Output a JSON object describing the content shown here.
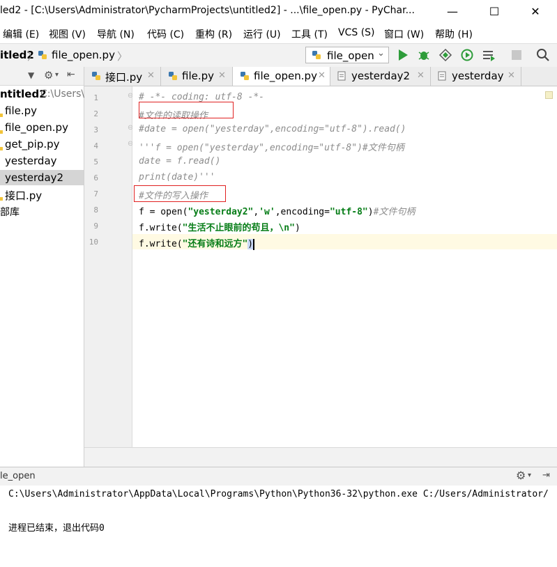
{
  "window": {
    "title": "led2 - [C:\\Users\\Administrator\\PycharmProjects\\untitled2] - ...\\file_open.py - PyChar...",
    "minimize": "—",
    "maximize": "☐",
    "close": "✕"
  },
  "menu": [
    "编辑 (E)",
    "视图 (V)",
    "导航 (N)",
    "代码 (C)",
    "重构 (R)",
    "运行 (U)",
    "工具 (T)",
    "VCS (S)",
    "窗口 (W)",
    "帮助 (H)"
  ],
  "breadcrumb": {
    "project": "itled2",
    "file": "file_open.py"
  },
  "run_config": {
    "name": "file_open"
  },
  "project_panel": {
    "root": "ntitled2",
    "root_path": "C:\\Users\\",
    "items": [
      "file.py",
      "file_open.py",
      "get_pip.py",
      "yesterday",
      "yesterday2",
      "接口.py",
      "部库"
    ],
    "selected_index": 4
  },
  "tabs": [
    {
      "label": "接口.py"
    },
    {
      "label": "file.py"
    },
    {
      "label": "file_open.py",
      "active": true
    },
    {
      "label": "yesterday2"
    },
    {
      "label": "yesterday"
    }
  ],
  "line_numbers": [
    "1",
    "2",
    "3",
    "4",
    "5",
    "6",
    "7",
    "8",
    "9",
    "10"
  ],
  "code": {
    "l1": "# -*- coding: utf-8 -*-",
    "l2": "#文件的读取操作",
    "l3": "#date = open(\"yesterday\",encoding=\"utf-8\").read()",
    "l4": "'''f = open(\"yesterday\",encoding=\"utf-8\")#文件句柄",
    "l5": "date = f.read()",
    "l6": "print(date)'''",
    "l7": "#文件的写入操作",
    "l8a": "f = open(",
    "l8b": "\"yesterday2\"",
    "l8c": ",",
    "l8d": "'w'",
    "l8e": ",encoding=",
    "l8f": "\"utf-8\"",
    "l8g": ")",
    "l8h": "#文件句柄",
    "l9a": "f.write(",
    "l9b": "\"生活不止眼前的苟且，\\n\"",
    "l9c": ")",
    "l10a": "f.write(",
    "l10b": "\"还有诗和远方\"",
    "l10c": ")"
  },
  "run_panel": {
    "label": "le_open",
    "command": "C:\\Users\\Administrator\\AppData\\Local\\Programs\\Python\\Python36-32\\python.exe C:/Users/Administrator/",
    "exit_message": "进程已结束，退出代码0"
  },
  "colors": {
    "accent_green": "#2e9c3a",
    "comment": "#8c8c8c",
    "string": "#067d17",
    "highlight_box": "#e02020",
    "current_line": "#fffae3"
  }
}
